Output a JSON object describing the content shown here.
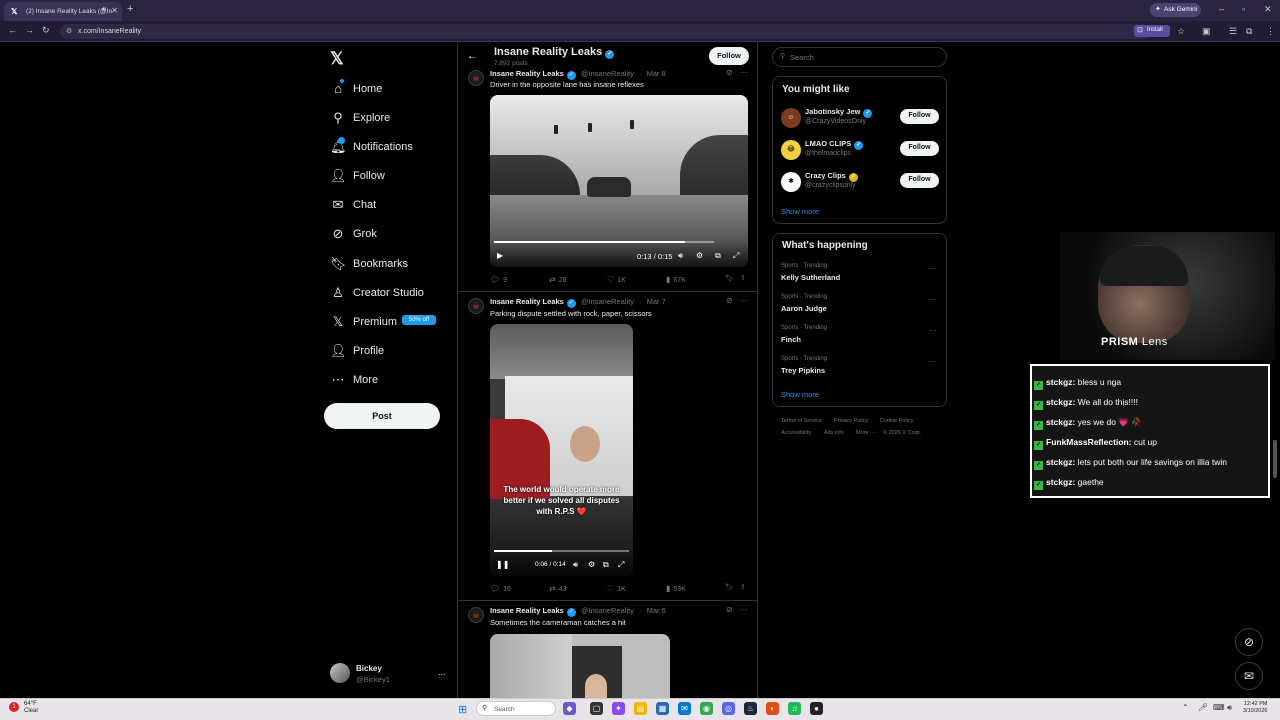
{
  "browser": {
    "tab_title": "(2) Insane Reality Leaks (@In",
    "tab_icon": "x-logo-icon",
    "ask_gemini": "Ask Gemini",
    "url": "x.com/InsaneReality",
    "install": "Install"
  },
  "nav": {
    "items": [
      {
        "label": "Home",
        "icon": "home-icon",
        "glyph": "⌂"
      },
      {
        "label": "Explore",
        "icon": "search-icon",
        "glyph": "⚲"
      },
      {
        "label": "Notifications",
        "icon": "bell-icon",
        "glyph": "🔔︎"
      },
      {
        "label": "Follow",
        "icon": "add-person-icon",
        "glyph": "👤︎"
      },
      {
        "label": "Chat",
        "icon": "mail-icon",
        "glyph": "✉"
      },
      {
        "label": "Grok",
        "icon": "grok-icon",
        "glyph": "⊘"
      },
      {
        "label": "Bookmarks",
        "icon": "bookmark-icon",
        "glyph": "🔖︎"
      },
      {
        "label": "Creator Studio",
        "icon": "creator-studio-icon",
        "glyph": "♙"
      },
      {
        "label": "Premium",
        "icon": "x-premium-icon",
        "glyph": "𝕏"
      },
      {
        "label": "Profile",
        "icon": "profile-icon",
        "glyph": "👤︎"
      },
      {
        "label": "More",
        "icon": "more-circle-icon",
        "glyph": "⋯"
      }
    ],
    "notifications_count": "2",
    "premium_badge": "50% off",
    "post_button": "Post",
    "account_name": "Bickey",
    "account_handle": "@Bickey1",
    "account_more": "..."
  },
  "profile": {
    "name": "Insane Reality Leaks",
    "posts_count": "7,892 posts",
    "follow_label": "Follow"
  },
  "tweets": [
    {
      "name": "Insane Reality Leaks",
      "handle": "@InsaneReality",
      "date": "Mar 8",
      "text": "Driver in the opposite lane has insane reflexes",
      "video_time": "0:13 / 0:15",
      "progress": 0.87,
      "replies": "9",
      "reposts": "28",
      "likes": "1K",
      "views": "67K"
    },
    {
      "name": "Insane Reality Leaks",
      "handle": "@InsaneReality",
      "date": "Mar 7",
      "text": "Parking dispute settled with rock, paper, scissors",
      "video_caption": "The world would operate more better if we solved all disputes with R.P.S ❤️",
      "video_time": "0:06 / 0:14",
      "progress": 0.43,
      "replies": "16",
      "reposts": "43",
      "likes": "1K",
      "views": "59K"
    },
    {
      "name": "Insane Reality Leaks",
      "handle": "@InsaneReality",
      "date": "Mar 6",
      "text": "Sometimes the cameraman catches a hit"
    }
  ],
  "sidebar": {
    "search_placeholder": "Search",
    "you_might_like_title": "You might like",
    "suggestions": [
      {
        "name": "Jabotinsky Jew",
        "handle": "@CrazyVideosOnly",
        "badge": "blue",
        "follow": "Follow"
      },
      {
        "name": "LMAO CLIPS",
        "handle": "@thelmaoclips",
        "badge": "blue",
        "follow": "Follow"
      },
      {
        "name": "Crazy Clips",
        "handle": "@crazyclipsonly",
        "badge": "gold",
        "follow": "Follow"
      }
    ],
    "show_more": "Show more",
    "whats_happening_title": "What's happening",
    "trends": [
      {
        "category": "Sports · Trending",
        "name": "Kelly Sutherland"
      },
      {
        "category": "Sports · Trending",
        "name": "Aaron Judge"
      },
      {
        "category": "Sports · Trending",
        "name": "Finch"
      },
      {
        "category": "Sports · Trending",
        "name": "Trey Pipkins"
      }
    ],
    "trends_show_more": "Show more",
    "footer": [
      "Terms of Service",
      "Privacy Policy",
      "Cookie Policy",
      "Accessibility",
      "Ads info",
      "More ···",
      "© 2026 X Corp."
    ]
  },
  "overlay": {
    "prism_bold": "PRISM",
    "prism_rest": " Lens",
    "chat": [
      {
        "user": "stckgz:",
        "msg": " bless u nga"
      },
      {
        "user": "stckgz:",
        "msg": " We all do this!!!!"
      },
      {
        "user": "stckgz:",
        "msg": " yes we do 💗 🥀"
      },
      {
        "user": "FunkMassReflection:",
        "msg": " cut up"
      },
      {
        "user": "stckgz:",
        "msg": " lets put both our life savings on illia twin"
      },
      {
        "user": "stckgz:",
        "msg": " gaethe"
      }
    ]
  },
  "taskbar": {
    "temp": "64°F",
    "weather": "Clear",
    "search": "Search",
    "time": "12:42 PM",
    "date": "3/10/2026"
  },
  "colors": {
    "accent": "#1d9bf0",
    "background": "#000000"
  }
}
